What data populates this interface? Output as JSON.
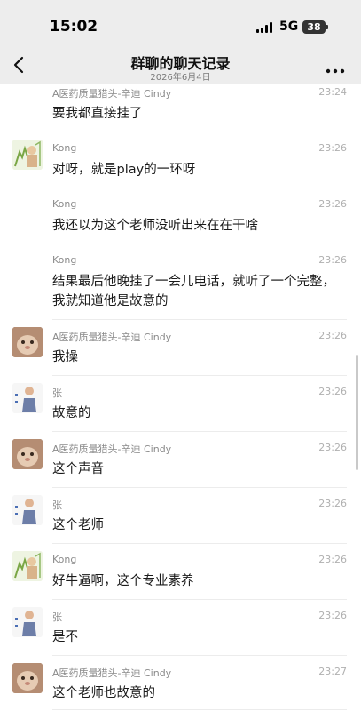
{
  "status_bar": {
    "time": "15:02",
    "network": "5G",
    "battery": "38"
  },
  "nav": {
    "title": "群聊的聊天记录",
    "subtitle": "2026年6月4日"
  },
  "messages": [
    {
      "sender": "A医药质量猎头-辛迪 Cindy",
      "time": "23:24",
      "lines": [
        "要我都直接挂了"
      ],
      "avatar": "none"
    },
    {
      "sender": "Kong",
      "time": "23:26",
      "lines": [
        "对呀，就是play的一环呀"
      ],
      "avatar": "kong"
    },
    {
      "sender": "Kong",
      "time": "23:26",
      "lines": [
        "我还以为这个老师没听出来在在干啥"
      ],
      "avatar": "none"
    },
    {
      "sender": "Kong",
      "time": "23:26",
      "lines": [
        "结果最后他晚挂了一会儿电话，就听了一个完整，",
        "我就知道他是故意的"
      ],
      "avatar": "none"
    },
    {
      "sender": "A医药质量猎头-辛迪 Cindy",
      "time": "23:26",
      "lines": [
        "我操"
      ],
      "avatar": "cindy"
    },
    {
      "sender": "张",
      "time": "23:26",
      "lines": [
        "故意的"
      ],
      "avatar": "zhang"
    },
    {
      "sender": "A医药质量猎头-辛迪 Cindy",
      "time": "23:26",
      "lines": [
        "这个声音"
      ],
      "avatar": "cindy"
    },
    {
      "sender": "张",
      "time": "23:26",
      "lines": [
        "这个老师"
      ],
      "avatar": "zhang"
    },
    {
      "sender": "Kong",
      "time": "23:26",
      "lines": [
        "好牛逼啊，这个专业素养"
      ],
      "avatar": "kong"
    },
    {
      "sender": "张",
      "time": "23:26",
      "lines": [
        "是不"
      ],
      "avatar": "zhang"
    },
    {
      "sender": "A医药质量猎头-辛迪 Cindy",
      "time": "23:27",
      "lines": [
        "这个老师也故意的"
      ],
      "avatar": "cindy"
    }
  ]
}
